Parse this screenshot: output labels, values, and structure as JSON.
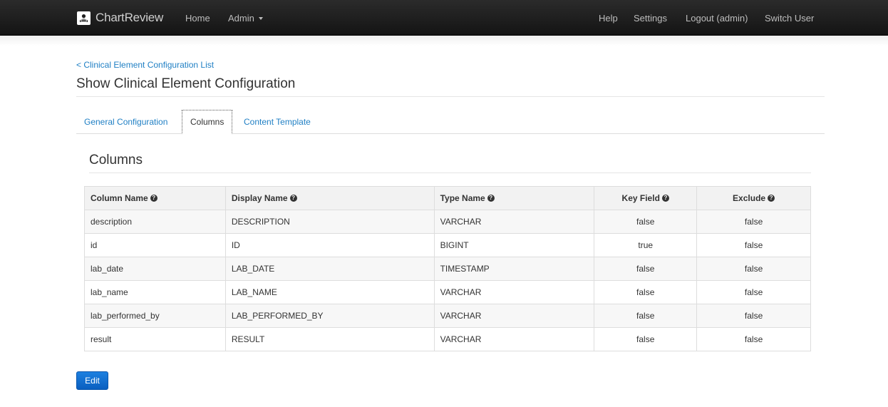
{
  "nav": {
    "brand": "ChartReview",
    "home": "Home",
    "admin": "Admin",
    "help": "Help",
    "settings": "Settings",
    "logout": "Logout (admin)",
    "switch_user": "Switch User"
  },
  "page": {
    "back_link": "< Clinical Element Configuration List",
    "title": "Show Clinical Element Configuration"
  },
  "tabs": [
    {
      "label": "General Configuration",
      "active": false
    },
    {
      "label": "Columns",
      "active": true
    },
    {
      "label": "Content Template",
      "active": false
    }
  ],
  "section_title": "Columns",
  "table": {
    "headers": [
      "Column Name",
      "Display Name",
      "Type Name",
      "Key Field",
      "Exclude"
    ],
    "rows": [
      [
        "description",
        "DESCRIPTION",
        "VARCHAR",
        "false",
        "false"
      ],
      [
        "id",
        "ID",
        "BIGINT",
        "true",
        "false"
      ],
      [
        "lab_date",
        "LAB_DATE",
        "TIMESTAMP",
        "false",
        "false"
      ],
      [
        "lab_name",
        "LAB_NAME",
        "VARCHAR",
        "false",
        "false"
      ],
      [
        "lab_performed_by",
        "LAB_PERFORMED_BY",
        "VARCHAR",
        "false",
        "false"
      ],
      [
        "result",
        "RESULT",
        "VARCHAR",
        "false",
        "false"
      ]
    ]
  },
  "actions": {
    "edit": "Edit"
  },
  "colors": {
    "navbar": "#1f1f1f",
    "link": "#1f7fc4",
    "primary_button": "#0a6fd6"
  },
  "icons": {
    "brand": "chartreview-logo-icon",
    "help": "question-circle-icon",
    "dropdown": "caret-down-icon"
  }
}
